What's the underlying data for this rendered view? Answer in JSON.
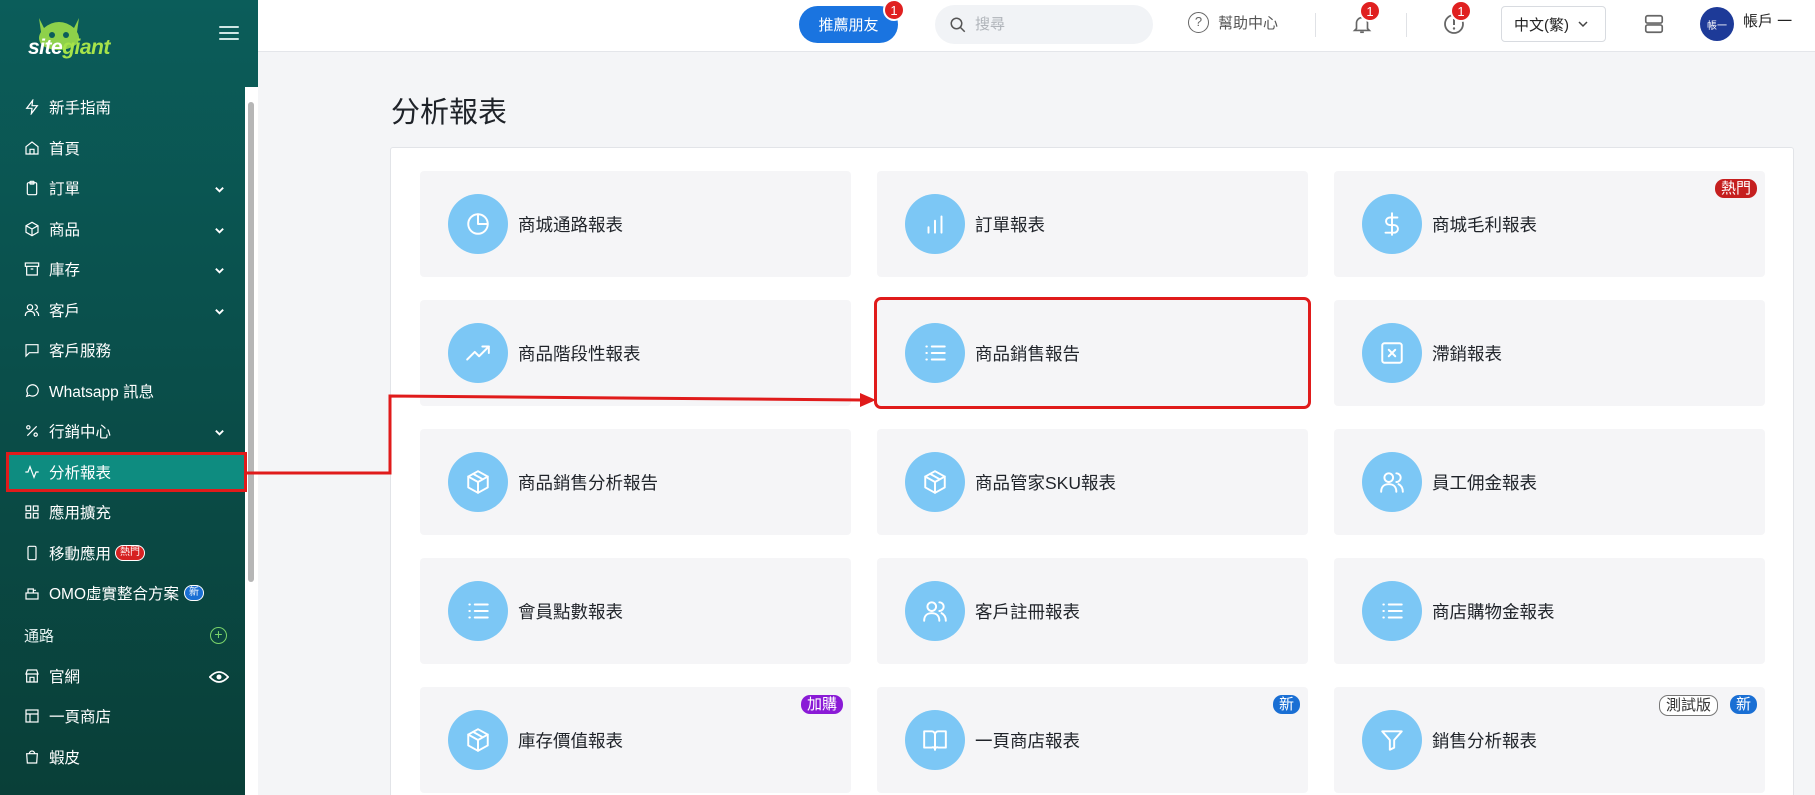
{
  "sidebar": {
    "logo": {
      "part1": "site",
      "part2": "giant"
    },
    "items": [
      {
        "label": "新手指南",
        "icon": "lightning-icon"
      },
      {
        "label": "首頁",
        "icon": "home-icon"
      },
      {
        "label": "訂單",
        "icon": "clipboard-icon"
      },
      {
        "label": "商品",
        "icon": "box-icon"
      },
      {
        "label": "庫存",
        "icon": "archive-icon"
      },
      {
        "label": "客戶",
        "icon": "users-icon"
      },
      {
        "label": "客戶服務",
        "icon": "chat-icon"
      },
      {
        "label": "Whatsapp 訊息",
        "icon": "whatsapp-icon"
      },
      {
        "label": "行銷中心",
        "icon": "percent-icon"
      },
      {
        "label": "分析報表",
        "icon": "activity-icon"
      },
      {
        "label": "應用擴充",
        "icon": "grid-icon"
      },
      {
        "label": "移動應用",
        "icon": "mobile-icon",
        "badge": "熱門"
      },
      {
        "label": "OMO虛實整合方案",
        "icon": "register-icon",
        "badge": "新"
      }
    ],
    "channels_title": "通路",
    "channels": [
      {
        "label": "官網",
        "icon": "store-icon"
      },
      {
        "label": "一頁商店",
        "icon": "page-icon"
      },
      {
        "label": "蝦皮",
        "icon": "shopee-icon"
      }
    ]
  },
  "topbar": {
    "refer_label": "推薦朋友",
    "refer_count": "1",
    "search_placeholder": "搜尋",
    "help_label": "幫助中心",
    "notif_count": "1",
    "alert_count": "1",
    "language": "中文(繁)",
    "avatar_text": "帳一",
    "account_label": "帳戶 一"
  },
  "page": {
    "title": "分析報表"
  },
  "reports": [
    {
      "label": "商城通路報表",
      "icon": "pie-chart-icon"
    },
    {
      "label": "訂單報表",
      "icon": "bar-chart-icon"
    },
    {
      "label": "商城毛利報表",
      "icon": "dollar-icon",
      "tag": "熱門"
    },
    {
      "label": "商品階段性報表",
      "icon": "trending-up-icon"
    },
    {
      "label": "商品銷售報告",
      "icon": "list-icon"
    },
    {
      "label": "滯銷報表",
      "icon": "x-square-icon"
    },
    {
      "label": "商品銷售分析報告",
      "icon": "package-icon"
    },
    {
      "label": "商品管家SKU報表",
      "icon": "package-icon"
    },
    {
      "label": "員工佣金報表",
      "icon": "users-icon"
    },
    {
      "label": "會員點數報表",
      "icon": "list-icon"
    },
    {
      "label": "客戶註冊報表",
      "icon": "users-icon"
    },
    {
      "label": "商店購物金報表",
      "icon": "list-icon"
    },
    {
      "label": "庫存價值報表",
      "icon": "package-icon",
      "tag": "加購"
    },
    {
      "label": "一頁商店報表",
      "icon": "book-icon",
      "tag": "新"
    },
    {
      "label": "銷售分析報表",
      "icon": "filter-icon",
      "tag": "測試版",
      "tag2": "新"
    }
  ]
}
